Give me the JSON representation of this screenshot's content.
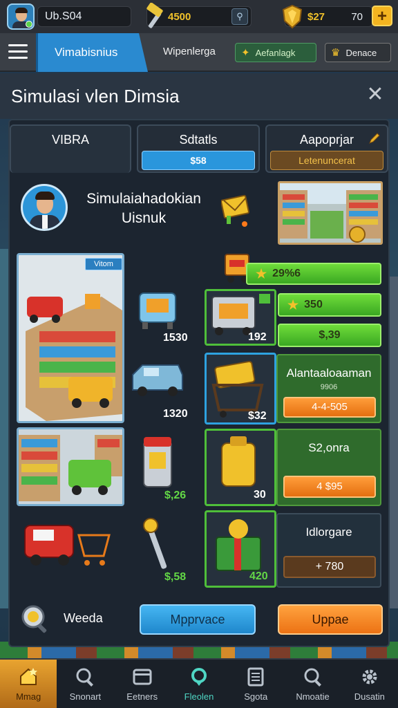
{
  "top": {
    "username": "Ub.S04",
    "cash": "4500",
    "gems": "$27",
    "gem_count": "70",
    "plus": "+"
  },
  "nav": {
    "tab": "Vimabisnius",
    "text": "Wipenlerga",
    "btn_green": "Aefanlagk",
    "btn_dark": "Denace"
  },
  "modal": {
    "title": "Simulasi vlen Dimsia",
    "close": "✕"
  },
  "tabs": [
    {
      "label": "VIBRA"
    },
    {
      "label": "Sdtatls",
      "bar": "$58"
    },
    {
      "label": "Aapoprjar",
      "bar": "Letenuncerat"
    }
  ],
  "profile": {
    "name": "Simulaiahadokian Uisnuk"
  },
  "items": {
    "tag": "Vitom",
    "truck_cart_value": "1530",
    "van_value": "1320",
    "scanner_value": "$,26",
    "wrench_value": "$,58",
    "trailer_value": "192",
    "basket_value": "$32",
    "bag_value": "30",
    "gift_value": "420"
  },
  "right": {
    "top_bar": "29%6",
    "bar2": "350",
    "bar3": "$,39",
    "panel1_title": "Alantaaloaaman",
    "panel1_sub": "9906",
    "panel1_btn": "4-4-505",
    "panel2_title": "S2,onra",
    "panel2_btn": "4 $95",
    "panel3_title": "Idlorgare",
    "panel3_btn": "+ 780"
  },
  "footer": {
    "label": "Weeda",
    "btn_blue": "Mpprvace",
    "btn_orange": "Uppae"
  },
  "bottom_nav": [
    {
      "label": "Mmag",
      "icon": "home-icon"
    },
    {
      "label": "Snonart",
      "icon": "search-icon"
    },
    {
      "label": "Eetners",
      "icon": "card-icon"
    },
    {
      "label": "Fleolen",
      "icon": "location-icon"
    },
    {
      "label": "Sgota",
      "icon": "list-icon"
    },
    {
      "label": "Nmoatie",
      "icon": "search-icon"
    },
    {
      "label": "Dusatin",
      "icon": "gear-icon"
    }
  ],
  "colors": {
    "accent_blue": "#2a8ad0",
    "accent_green": "#4fbf3a",
    "accent_orange": "#ec7214",
    "gold": "#f0c12b"
  }
}
